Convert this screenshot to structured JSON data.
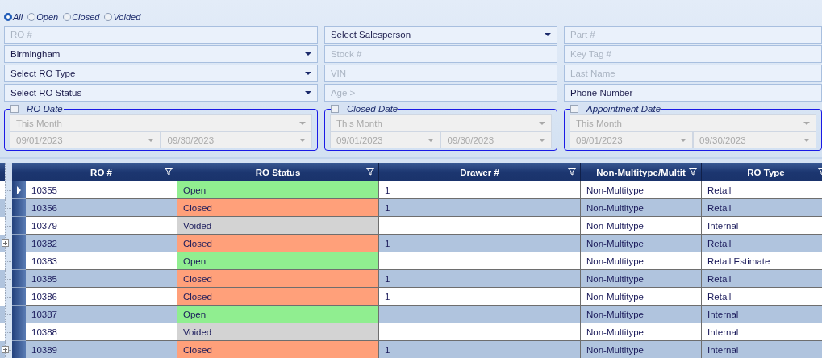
{
  "status_filter": [
    {
      "label": "All",
      "selected": true
    },
    {
      "label": "Open",
      "selected": false
    },
    {
      "label": "Closed",
      "selected": false
    },
    {
      "label": "Voided",
      "selected": false
    }
  ],
  "filter_columns": [
    [
      {
        "kind": "text",
        "placeholder": "RO #"
      },
      {
        "kind": "dropdown",
        "value": "Birmingham"
      },
      {
        "kind": "dropdown",
        "value": "Select RO Type"
      },
      {
        "kind": "dropdown",
        "value": "Select RO Status"
      }
    ],
    [
      {
        "kind": "dropdown",
        "value": "Select Salesperson"
      },
      {
        "kind": "text",
        "placeholder": "Stock #"
      },
      {
        "kind": "text",
        "placeholder": "VIN"
      },
      {
        "kind": "text",
        "placeholder": "Age >"
      }
    ],
    [
      {
        "kind": "text",
        "placeholder": "Part #"
      },
      {
        "kind": "text",
        "placeholder": "Key Tag #"
      },
      {
        "kind": "text",
        "placeholder": "Last Name"
      },
      {
        "kind": "text",
        "value": "Phone Number"
      }
    ]
  ],
  "date_groups": [
    {
      "title": "RO Date",
      "checked": false,
      "period": "This Month",
      "from": "09/01/2023",
      "to": "09/30/2023"
    },
    {
      "title": "Closed Date",
      "checked": false,
      "period": "This Month",
      "from": "09/01/2023",
      "to": "09/30/2023"
    },
    {
      "title": "Appointment Date",
      "checked": false,
      "period": "This Month",
      "from": "09/01/2023",
      "to": "09/30/2023"
    }
  ],
  "grid": {
    "columns": [
      "RO #",
      "RO Status",
      "Drawer #",
      "Non-Multitype/Multit",
      "RO Type"
    ],
    "rows": [
      {
        "current": true,
        "expandable": false,
        "ro": "10355",
        "status": {
          "text": "Open",
          "color": "#90ee90"
        },
        "drawer": "1",
        "multitype": "Non-Multitype",
        "type": "Retail"
      },
      {
        "current": false,
        "expandable": false,
        "ro": "10356",
        "status": {
          "text": "Closed",
          "color": "#ffa07a"
        },
        "drawer": "1",
        "multitype": "Non-Multitype",
        "type": "Retail"
      },
      {
        "current": false,
        "expandable": false,
        "ro": "10379",
        "status": {
          "text": "Voided",
          "color": "#d3d3d3"
        },
        "multitype": "Non-Multitype",
        "type": "Internal"
      },
      {
        "current": false,
        "expandable": true,
        "ro": "10382",
        "status": {
          "text": "Closed",
          "color": "#ffa07a"
        },
        "drawer": "1",
        "multitype": "Non-Multitype",
        "type": "Retail"
      },
      {
        "current": false,
        "expandable": false,
        "ro": "10383",
        "status": {
          "text": "Open",
          "color": "#90ee90"
        },
        "multitype": "Non-Multitype",
        "type": "Retail Estimate"
      },
      {
        "current": false,
        "expandable": false,
        "ro": "10385",
        "status": {
          "text": "Closed",
          "color": "#ffa07a"
        },
        "drawer": "1",
        "multitype": "Non-Multitype",
        "type": "Retail"
      },
      {
        "current": false,
        "expandable": false,
        "ro": "10386",
        "status": {
          "text": "Closed",
          "color": "#ffa07a"
        },
        "drawer": "1",
        "multitype": "Non-Multitype",
        "type": "Retail"
      },
      {
        "current": false,
        "expandable": false,
        "ro": "10387",
        "status": {
          "text": "Open",
          "color": "#90ee90"
        },
        "multitype": "Non-Multitype",
        "type": "Internal"
      },
      {
        "current": false,
        "expandable": false,
        "ro": "10388",
        "status": {
          "text": "Voided",
          "color": "#d3d3d3"
        },
        "multitype": "Non-Multitype",
        "type": "Internal"
      },
      {
        "current": false,
        "expandable": true,
        "ro": "10389",
        "status": {
          "text": "Closed",
          "color": "#ffa07a"
        },
        "drawer": "1",
        "multitype": "Non-Multitype",
        "type": "Internal"
      }
    ]
  }
}
